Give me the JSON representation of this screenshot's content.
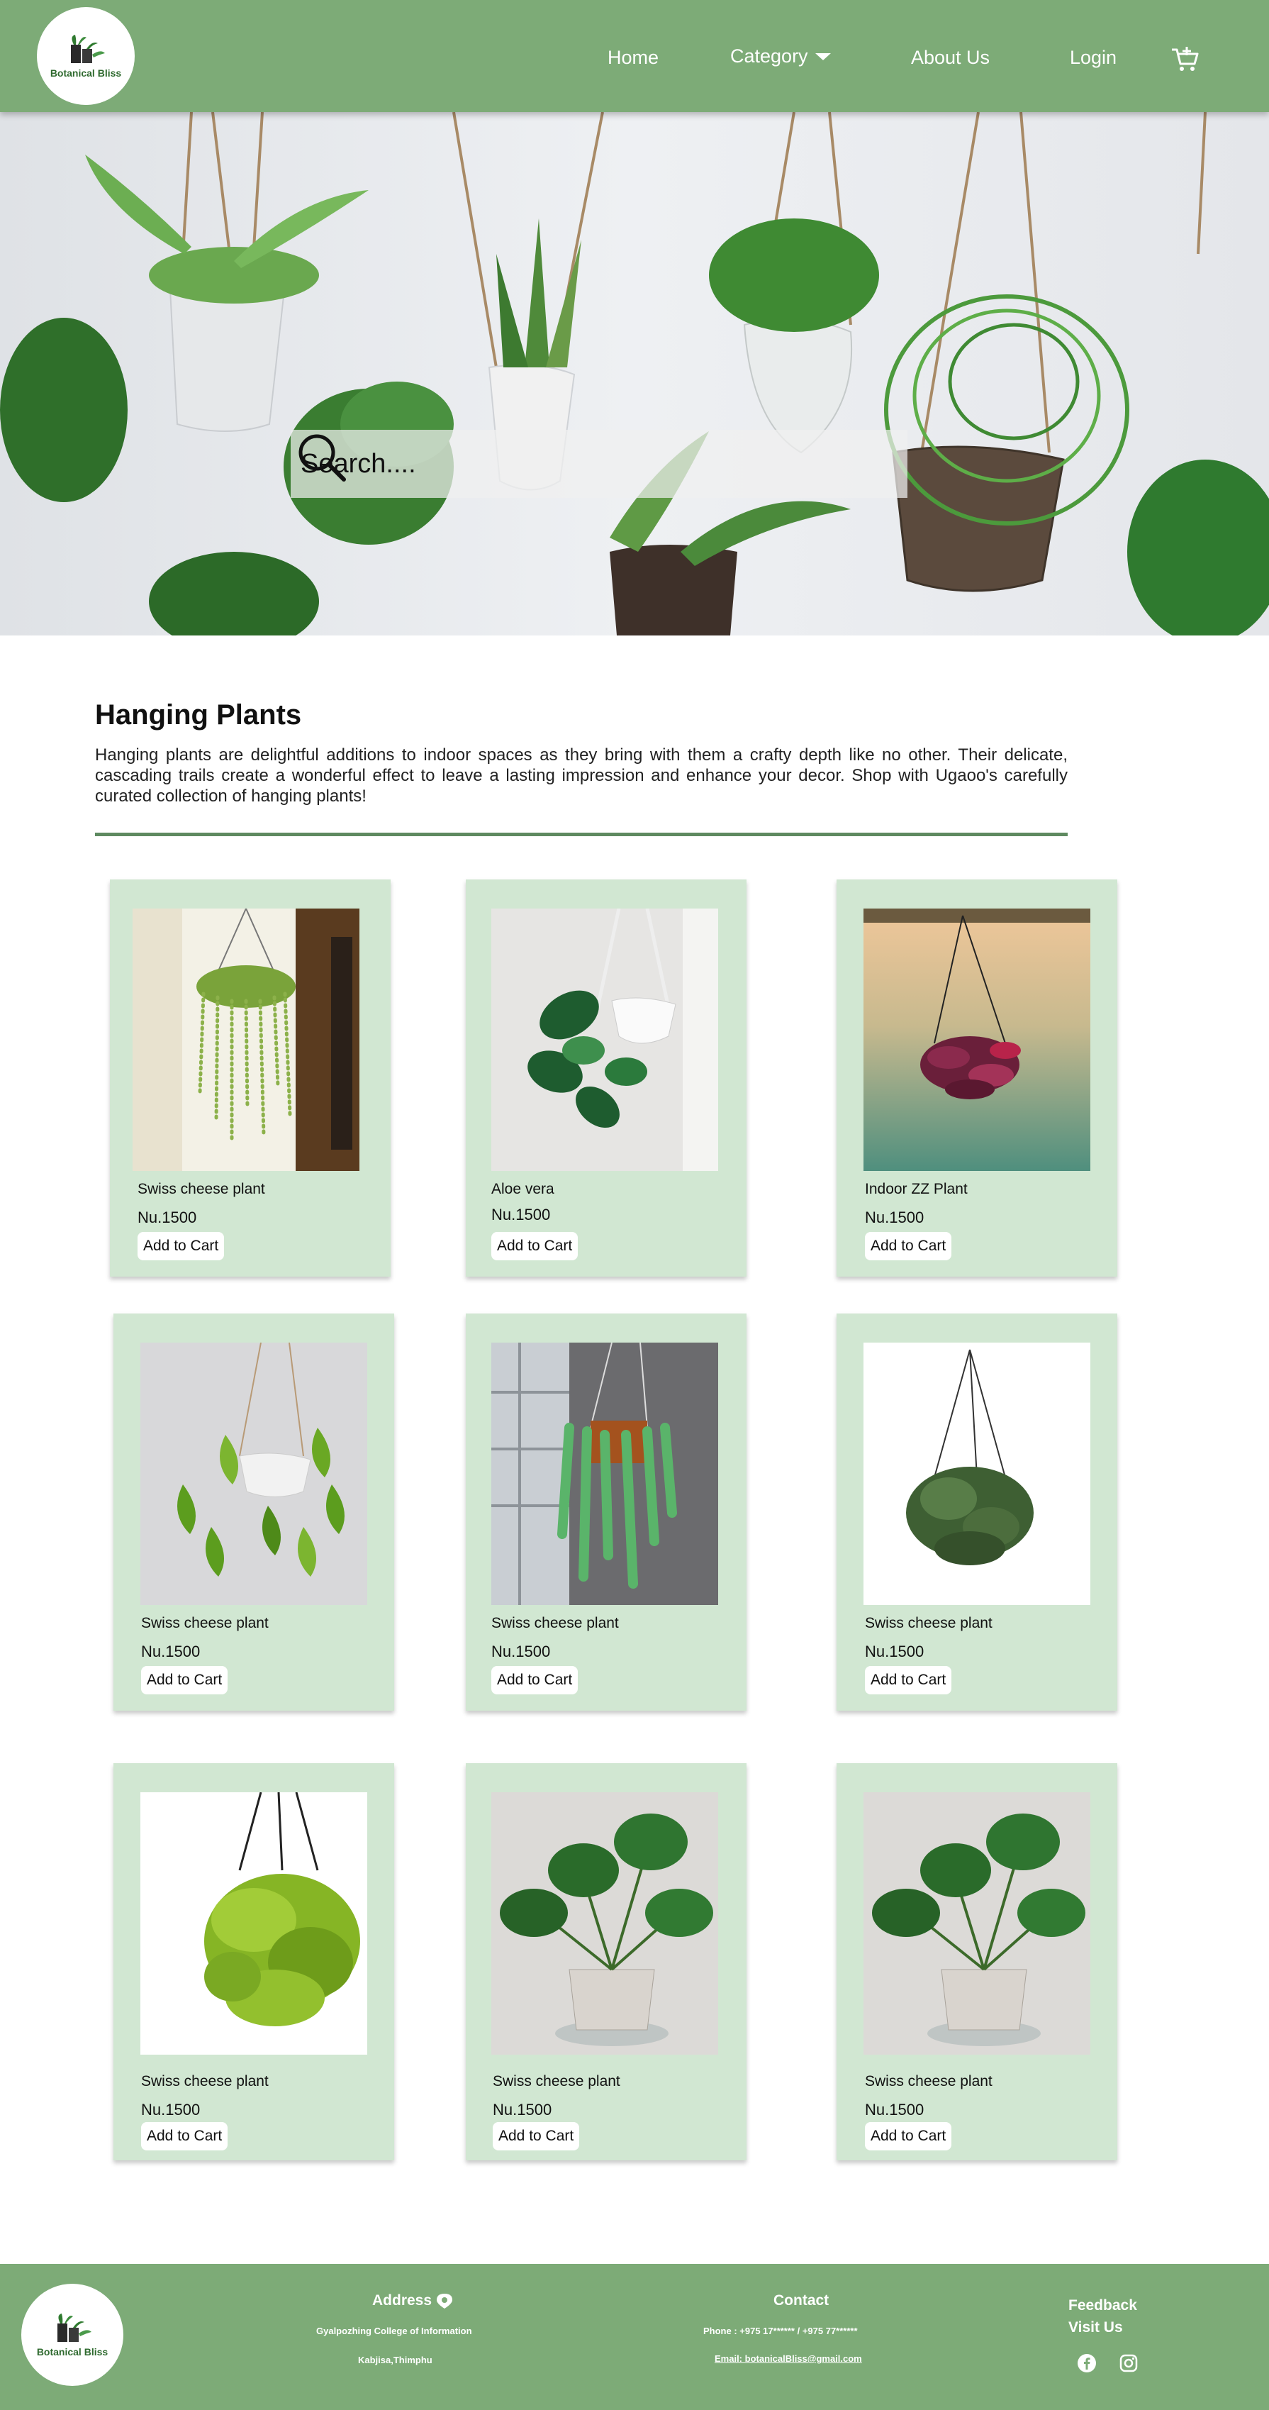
{
  "brand": {
    "name": "Botanical Bliss"
  },
  "nav": {
    "home": "Home",
    "category": "Category",
    "about": "About Us",
    "login": "Login",
    "cart_icon": "cart-icon"
  },
  "search": {
    "placeholder": "Search...."
  },
  "section": {
    "title": "Hanging Plants",
    "description": "Hanging plants are delightful additions to indoor spaces as they bring with them a crafty depth like no other. Their delicate, cascading trails create a wonderful effect to leave a lasting impression and enhance your decor. Shop with Ugaoo's carefully curated collection of hanging plants!"
  },
  "products": [
    {
      "name": "Swiss cheese plant",
      "price": "Nu.1500",
      "button": "Add to Cart",
      "image": "string-of-pearls-hanging"
    },
    {
      "name": "Aloe vera",
      "price": "Nu.1500",
      "button": "Add to Cart",
      "image": "monstera-hanging"
    },
    {
      "name": "Indoor ZZ Plant",
      "price": "Nu.1500",
      "button": "Add to Cart",
      "image": "purple-tradescantia-hanging"
    },
    {
      "name": "Swiss cheese plant",
      "price": "Nu.1500",
      "button": "Add to Cart",
      "image": "pothos-hanging"
    },
    {
      "name": "Swiss cheese plant",
      "price": "Nu.1500",
      "button": "Add to Cart",
      "image": "burros-tail-hanging"
    },
    {
      "name": "Swiss cheese plant",
      "price": "Nu.1500",
      "button": "Add to Cart",
      "image": "ivy-basket-hanging"
    },
    {
      "name": "Swiss cheese plant",
      "price": "Nu.1500",
      "button": "Add to Cart",
      "image": "lime-creeper-hanging"
    },
    {
      "name": "Swiss cheese plant",
      "price": "Nu.1500",
      "button": "Add to Cart",
      "image": "monstera-pot"
    },
    {
      "name": "Swiss cheese plant",
      "price": "Nu.1500",
      "button": "Add to Cart",
      "image": "monstera-pot"
    }
  ],
  "footer": {
    "address_title": "Address",
    "address_line1": "Gyalpozhing College of Information",
    "address_line2": "Kabjisa,Thimphu",
    "contact_title": "Contact",
    "phone": "Phone : +975 17****** / +975 77******",
    "email": "Email: botanicalBliss@gmail.com",
    "feedback": "Feedback",
    "visit": "Visit Us"
  },
  "colors": {
    "header_bg": "#7dab77",
    "card_bg": "#d1e7d2",
    "divider": "#5e8a60",
    "footer_bg": "#7dab77"
  }
}
